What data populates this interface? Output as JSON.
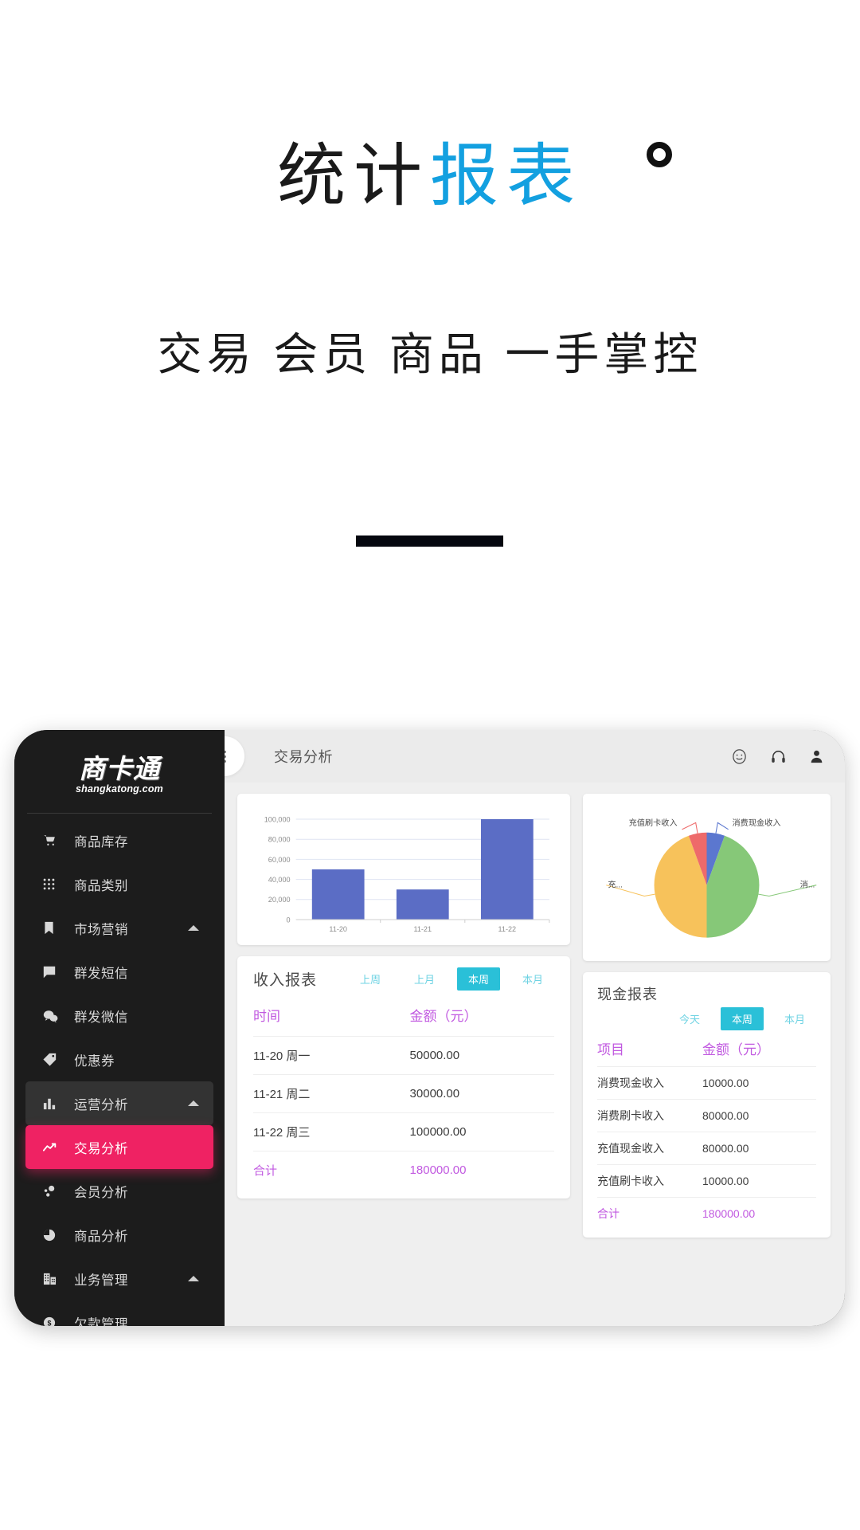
{
  "hero": {
    "title_dark": "统计",
    "title_blue": "报表",
    "superscript": "circle-mark",
    "subtitle": "交易 会员 商品 一手掌控",
    "accent_blue": "#13a0e0"
  },
  "sidebar": {
    "logo_main": "商卡通",
    "logo_sub": "shangkatong.com",
    "items": [
      {
        "label": "商品库存",
        "icon": "cart-icon",
        "caret": false,
        "state": "normal"
      },
      {
        "label": "商品类别",
        "icon": "grid-icon",
        "caret": false,
        "state": "normal"
      },
      {
        "label": "市场营销",
        "icon": "bookmark-icon",
        "caret": true,
        "state": "normal"
      },
      {
        "label": "群发短信",
        "icon": "message-icon",
        "caret": false,
        "state": "normal"
      },
      {
        "label": "群发微信",
        "icon": "wechat-icon",
        "caret": false,
        "state": "normal"
      },
      {
        "label": "优惠券",
        "icon": "tag-icon",
        "caret": false,
        "state": "normal"
      },
      {
        "label": "运营分析",
        "icon": "bar-chart-icon",
        "caret": true,
        "state": "group-on"
      },
      {
        "label": "交易分析",
        "icon": "trend-up-icon",
        "caret": false,
        "state": "active"
      },
      {
        "label": "会员分析",
        "icon": "members-icon",
        "caret": false,
        "state": "normal"
      },
      {
        "label": "商品分析",
        "icon": "pie-chart-icon",
        "caret": false,
        "state": "normal"
      },
      {
        "label": "业务管理",
        "icon": "building-icon",
        "caret": true,
        "state": "normal"
      },
      {
        "label": "欠款管理",
        "icon": "dollar-icon",
        "caret": false,
        "state": "normal"
      }
    ],
    "active_color": "#ef2263"
  },
  "topbar": {
    "menu_icon": "more-vertical-icon",
    "title": "交易分析",
    "icons": [
      "smiley-icon",
      "headset-icon",
      "user-icon"
    ]
  },
  "income_report": {
    "title": "收入报表",
    "tabs": [
      {
        "label": "上周",
        "active": false
      },
      {
        "label": "上月",
        "active": false
      },
      {
        "label": "本周",
        "active": true
      },
      {
        "label": "本月",
        "active": false
      }
    ],
    "columns": [
      "时间",
      "金额（元）"
    ],
    "rows": [
      [
        "11-20 周一",
        "50000.00"
      ],
      [
        "11-21 周二",
        "30000.00"
      ],
      [
        "11-22 周三",
        "100000.00"
      ]
    ],
    "total_label": "合计",
    "total_value": "180000.00",
    "accent_color": "#c159e0",
    "tab_active_color": "#2ac0d8"
  },
  "cash_report": {
    "title": "现金报表",
    "tabs": [
      {
        "label": "今天",
        "active": false
      },
      {
        "label": "本周",
        "active": true
      },
      {
        "label": "本月",
        "active": false
      }
    ],
    "columns": [
      "项目",
      "金额（元）"
    ],
    "rows": [
      [
        "消费现金收入",
        "10000.00"
      ],
      [
        "消费刷卡收入",
        "80000.00"
      ],
      [
        "充值现金收入",
        "80000.00"
      ],
      [
        "充值刷卡收入",
        "10000.00"
      ]
    ],
    "total_label": "合计",
    "total_value": "180000.00"
  },
  "chart_data": [
    {
      "type": "bar",
      "title": "",
      "categories": [
        "11-20",
        "11-21",
        "11-22"
      ],
      "values": [
        50000,
        30000,
        100000
      ],
      "ylim": [
        0,
        100000
      ],
      "yticks": [
        0,
        20000,
        40000,
        60000,
        80000,
        100000
      ],
      "ytick_labels": [
        "0",
        "20,000",
        "40,000",
        "60,000",
        "80,000",
        "100,000"
      ],
      "xlabel": "",
      "ylabel": "",
      "grid": true,
      "legend": "none",
      "bar_color": "#5b6dc5"
    },
    {
      "type": "pie",
      "title": "",
      "labels": [
        "消费现金收入",
        "消费刷卡收入",
        "充值现金收入",
        "充值刷卡收入"
      ],
      "short_labels": [
        "消费现金收入",
        "消...",
        "充...",
        "充值刷卡收入"
      ],
      "values": [
        10000,
        80000,
        80000,
        10000
      ],
      "percents": [
        5.6,
        44.4,
        44.4,
        5.6
      ],
      "colors": [
        "#5b77cf",
        "#86c878",
        "#f6c košt"
      ],
      "slice_colors": [
        "#5b77cf",
        "#86c878",
        "#f7c25b",
        "#ee6a6a"
      ],
      "legend": "callout-labels"
    }
  ]
}
